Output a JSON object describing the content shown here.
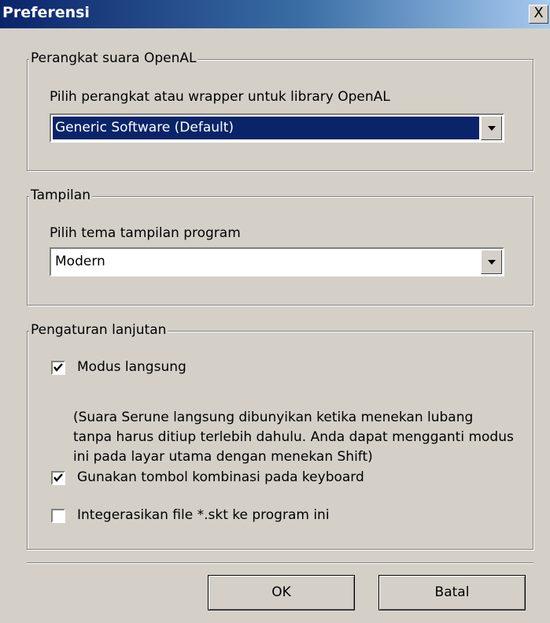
{
  "window": {
    "title": "Preferensi",
    "close_glyph": "X"
  },
  "openal": {
    "group_title": "Perangkat suara OpenAL",
    "label": "Pilih perangkat atau wrapper untuk library OpenAL",
    "selected": "Generic Software (Default)"
  },
  "display": {
    "group_title": "Tampilan",
    "label": "Pilih tema tampilan program",
    "selected": "Modern"
  },
  "advanced": {
    "group_title": "Pengaturan lanjutan",
    "direct_mode": {
      "label": "Modus langsung",
      "checked": true
    },
    "direct_mode_note": "(Suara Serune langsung dibunyikan ketika menekan lubang tanpa harus ditiup terlebih dahulu. Anda dapat mengganti modus ini pada layar utama dengan menekan Shift)",
    "keyboard_combo": {
      "label": "Gunakan tombol kombinasi pada keyboard",
      "checked": true
    },
    "integrate_skt": {
      "label": "Integerasikan file *.skt ke program ini",
      "checked": false
    }
  },
  "buttons": {
    "ok": "OK",
    "cancel": "Batal"
  },
  "colors": {
    "title_start": "#0a246a",
    "title_end": "#a6caf0",
    "face": "#d4d0c8",
    "selection": "#0a246a"
  }
}
